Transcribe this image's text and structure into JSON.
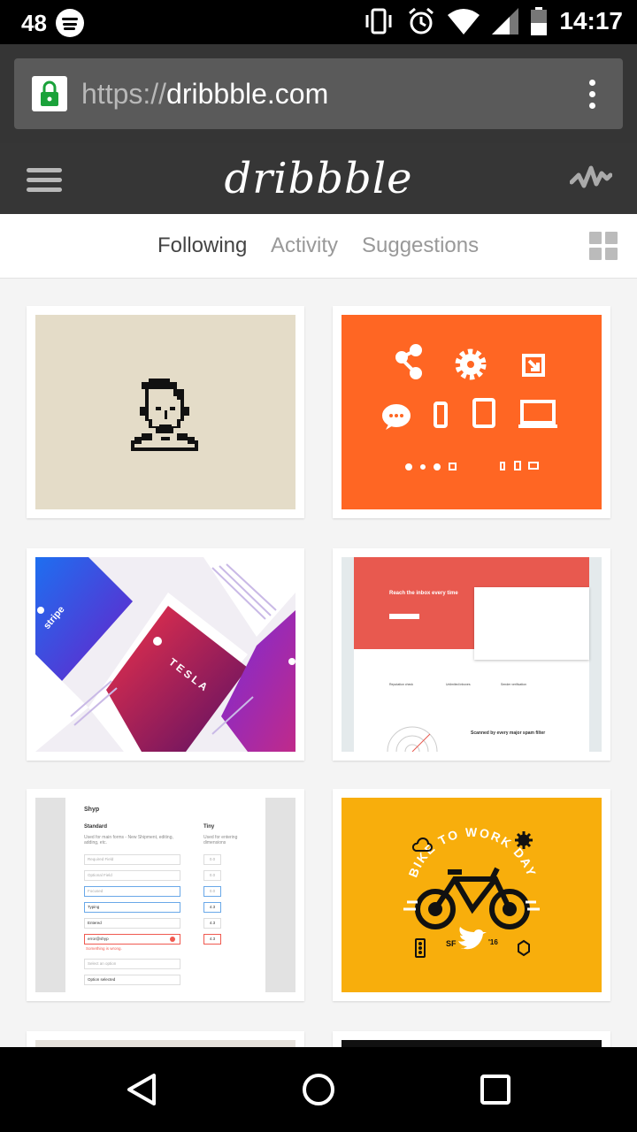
{
  "status": {
    "notification_count": "48",
    "time": "14:17"
  },
  "browser": {
    "url_protocol": "https://",
    "url_domain": "dribbble.com"
  },
  "app": {
    "logo": "dribbble"
  },
  "tabs": [
    {
      "label": "Following",
      "active": true
    },
    {
      "label": "Activity",
      "active": false
    },
    {
      "label": "Suggestions",
      "active": false
    }
  ],
  "shots": {
    "tesla": {
      "brand": "TESLA",
      "stripe": "stripe"
    },
    "email": {
      "headline": "Reach the inbox every time",
      "footer": "Scanned by every major spam filter",
      "f1": "Reputation check",
      "f2": "Unlimited inboxes",
      "f3": "Sender verification"
    },
    "forms": {
      "brand": "Shyp",
      "col1_title": "Standard",
      "col1_desc": "Used for main forms - New Shipment, editing, adding, etc.",
      "col2_title": "Tiny",
      "col2_desc": "Used for entering dimensions",
      "fields": [
        "Required Field",
        "Optional Field",
        "Focused",
        "Typing",
        "Entered",
        "error@shyp"
      ],
      "error_msg": "Something is wrong.",
      "select_placeholder": "Select an option",
      "select_value": "Option selected",
      "tiny_values": [
        "0.0",
        "0.0",
        "0.0",
        "4.3",
        "4.3",
        "4.3"
      ]
    },
    "bike": {
      "arc_text": "BIKE TO WORK DAY",
      "location": "SF",
      "year": "'16"
    }
  },
  "colors": {
    "accent_orange": "#ff6623",
    "bike_yellow": "#f8ae0c",
    "cream": "#e4dcc8",
    "email_red": "#e8594f"
  }
}
